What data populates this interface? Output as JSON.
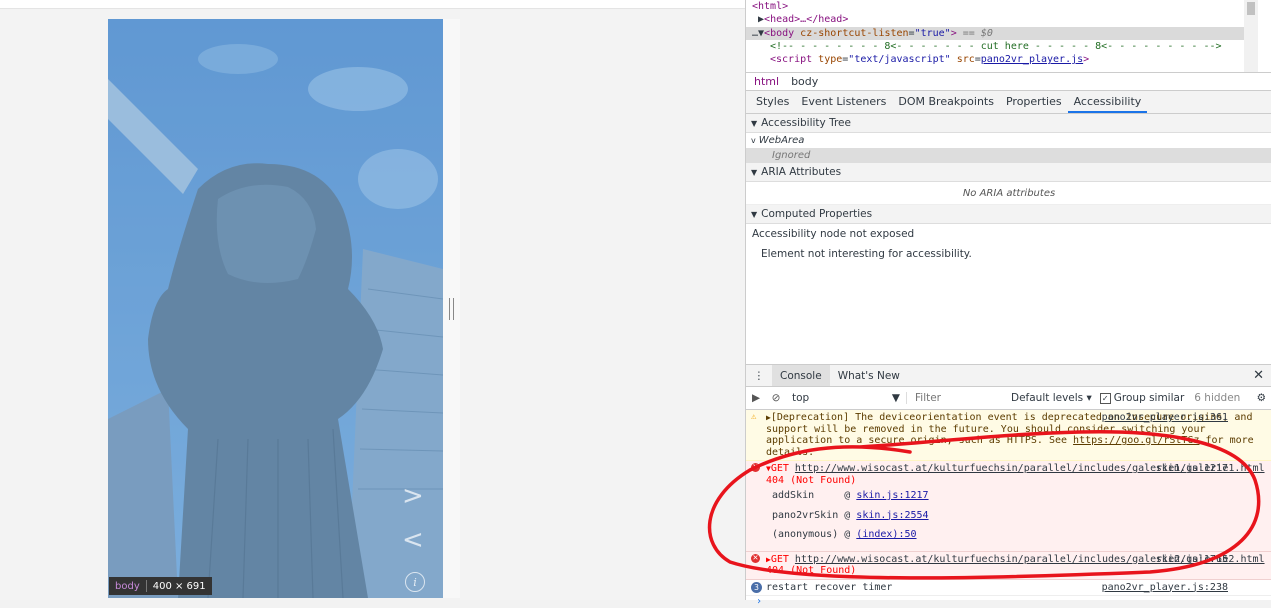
{
  "page": {
    "hover_label": {
      "tag": "body",
      "size": "400 × 691"
    }
  },
  "devtools": {
    "elements": {
      "lines": [
        "<html>",
        "<head>…</head>",
        "<body cz-shortcut-listen=\"true\"> == $0",
        "<!-- - - - - - - - 8<- - - - - - - cut here - - - - - 8<- - - - - - - - -->",
        "<script type=\"text/javascript\" src=\"pano2vr_player.js\">"
      ],
      "body_attr_name": "cz-shortcut-listen",
      "body_attr_value": "\"true\"",
      "selected_marker": "== $0",
      "comment": "<!-- - - - - - - - 8<- - - - - - - cut here - - - - - 8<- - - - - - - - -->",
      "script_src": "pano2vr_player.js"
    },
    "breadcrumbs": [
      "html",
      "body"
    ],
    "subtabs": [
      "Styles",
      "Event Listeners",
      "DOM Breakpoints",
      "Properties",
      "Accessibility"
    ],
    "accessibility": {
      "tree_header": "Accessibility Tree",
      "webarea": "WebArea",
      "ignored": "Ignored",
      "aria_header": "ARIA Attributes",
      "no_aria": "No ARIA attributes",
      "computed_header": "Computed Properties",
      "not_exposed": "Accessibility node not exposed",
      "not_interesting": "Element not interesting for accessibility."
    },
    "drawer": {
      "tabs": [
        "Console",
        "What's New"
      ],
      "context": "top",
      "filter_placeholder": "Filter",
      "levels": "Default levels",
      "group_similar": "Group similar",
      "hidden": "6 hidden"
    },
    "console": {
      "warning": {
        "text_prefix": "[Deprecation] The deviceorientation event is deprecated on insecure origins, and support will be removed in the future. You should consider switching your application to a secure origin, such as HTTPS. See ",
        "link": "https://goo.gl/rStTGz",
        "text_suffix": " for more details.",
        "source": "pano2vr_player.js:361"
      },
      "error1": {
        "method": "GET",
        "url": "http://www.wisocast.at/kulturfuechsin/parallel/includes/galerie1/galerie1.html",
        "status": "404 (Not Found)",
        "source": "skin.js:1217",
        "stack": [
          {
            "fn": "addSkin",
            "loc": "skin.js:1217"
          },
          {
            "fn": "pano2vrSkin",
            "loc": "skin.js:2554"
          },
          {
            "fn": "(anonymous)",
            "loc": "(index):50"
          }
        ]
      },
      "error2": {
        "method": "GET",
        "url": "http://www.wisocast.at/kulturfuechsin/parallel/includes/galerie2/galerie2.html",
        "status": "404 (Not Found)",
        "source": "skin.js:1765"
      },
      "info": {
        "count": "3",
        "text": "restart recover timer",
        "source": "pano2vr_player.js:238"
      }
    },
    "colors": {
      "accent": "#1a73e8",
      "error": "#ff0000",
      "annotation": "#e8141c"
    }
  }
}
